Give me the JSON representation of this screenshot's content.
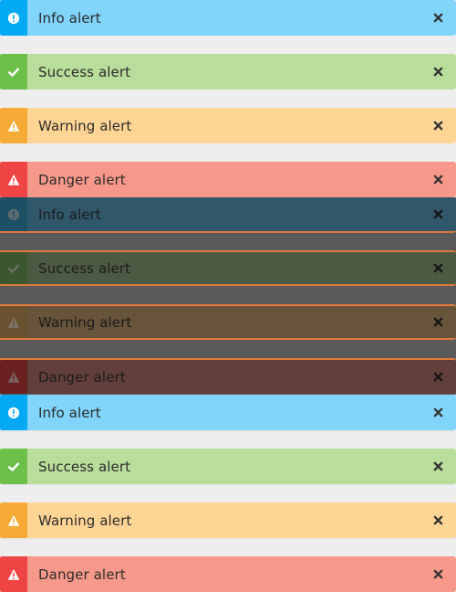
{
  "alerts": [
    {
      "variant": "info",
      "label": "Info alert",
      "icon": "exclamation-circle-icon",
      "state": "normal"
    },
    {
      "variant": "success",
      "label": "Success alert",
      "icon": "check-icon",
      "state": "normal"
    },
    {
      "variant": "warning",
      "label": "Warning alert",
      "icon": "warning-triangle-icon",
      "state": "normal"
    },
    {
      "variant": "danger",
      "label": "Danger alert",
      "icon": "warning-triangle-icon",
      "state": "normal"
    },
    {
      "variant": "info",
      "label": "Info alert",
      "icon": "exclamation-circle-icon",
      "state": "dimmed"
    },
    {
      "variant": "success",
      "label": "Success alert",
      "icon": "check-icon",
      "state": "dimmed"
    },
    {
      "variant": "warning",
      "label": "Warning alert",
      "icon": "warning-triangle-icon",
      "state": "dimmed"
    },
    {
      "variant": "danger",
      "label": "Danger alert",
      "icon": "warning-triangle-icon",
      "state": "dimmed"
    },
    {
      "variant": "info",
      "label": "Info alert",
      "icon": "exclamation-circle-icon",
      "state": "normal"
    },
    {
      "variant": "success",
      "label": "Success alert",
      "icon": "check-icon",
      "state": "normal"
    },
    {
      "variant": "warning",
      "label": "Warning alert",
      "icon": "warning-triangle-icon",
      "state": "normal"
    },
    {
      "variant": "danger",
      "label": "Danger alert",
      "icon": "warning-triangle-icon",
      "state": "normal"
    }
  ],
  "close_icon": "close-icon",
  "colors": {
    "info_bg": "#81d4fa",
    "info_accent": "#03a9f4",
    "success_bg": "#b9dd9b",
    "success_accent": "#6cc04a",
    "warning_bg": "#ffd596",
    "warning_accent": "#f5ab35",
    "danger_bg": "#f7998a",
    "danger_accent": "#ee4444",
    "page_bg": "#eeeeee",
    "backdrop": "#5a5a5a"
  }
}
